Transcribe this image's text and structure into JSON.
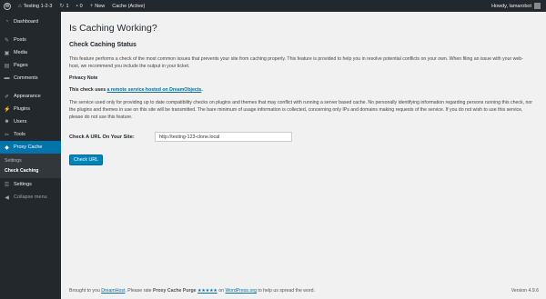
{
  "adminbar": {
    "wp_logo": "W",
    "site_name": "Testing 1-2-3",
    "updates_count": "1",
    "comments_count": "0",
    "new_label": "New",
    "cache_label": "Cache (Active)",
    "howdy": "Howdy, lamarobot"
  },
  "sidebar": {
    "items": [
      {
        "label": "Dashboard",
        "icon": "dashboard-icon"
      },
      {
        "label": "Posts",
        "icon": "pin-icon"
      },
      {
        "label": "Media",
        "icon": "media-icon"
      },
      {
        "label": "Pages",
        "icon": "pages-icon"
      },
      {
        "label": "Comments",
        "icon": "comments-icon"
      },
      {
        "label": "Appearance",
        "icon": "brush-icon"
      },
      {
        "label": "Plugins",
        "icon": "plugin-icon"
      },
      {
        "label": "Users",
        "icon": "users-icon"
      },
      {
        "label": "Tools",
        "icon": "wrench-icon"
      },
      {
        "label": "Proxy Cache",
        "icon": "cache-icon"
      }
    ],
    "submenu": [
      "Settings",
      "Check Caching"
    ],
    "settings_label": "Settings",
    "collapse_label": "Collapse menu"
  },
  "page": {
    "title": "Is Caching Working?",
    "section_title": "Check Caching Status",
    "intro": "This feature performs a check of the most common issues that prevents your site from caching properly. This feature is provided to help you in resolve potential conflicts on your own. When filing an issue with your web-host, we recommend you include the output in your ticket.",
    "privacy_heading": "Privacy Note",
    "privacy_prefix": "This check uses ",
    "privacy_link": "a remote service hosted on DreamObjects",
    "privacy_suffix": ".",
    "privacy_text": "The service used only for providing up to date compatibility checks on plugins and themes that may conflict with running a server based cache. No personally identifying information regarding persons running this check, nor the plugins and themes in use on this site will be transmitted. The bare minimum of usage information is collected, concerning only IPs and domains making requests of the service. If you do not wish to use this service, please do not use this feature.",
    "url_label": "Check A URL On Your Site:",
    "url_value": "http://testing-123-clone.local",
    "button_label": "Check URL"
  },
  "footer": {
    "brought_prefix": "Brought to you ",
    "brought_link": "DreamHost",
    "rate_text": ". Please rate ",
    "plugin_name": "Proxy Cache Purge",
    "stars": "★★★★★",
    "on_text": " on ",
    "wp_link": "WordPress.org",
    "suffix": " to help us spread the word.",
    "version": "Version 4.9.6"
  },
  "colors": {
    "adminbar_bg": "#23282d",
    "accent": "#0073aa",
    "button": "#0085ba",
    "page_bg": "#f1f1f1"
  }
}
